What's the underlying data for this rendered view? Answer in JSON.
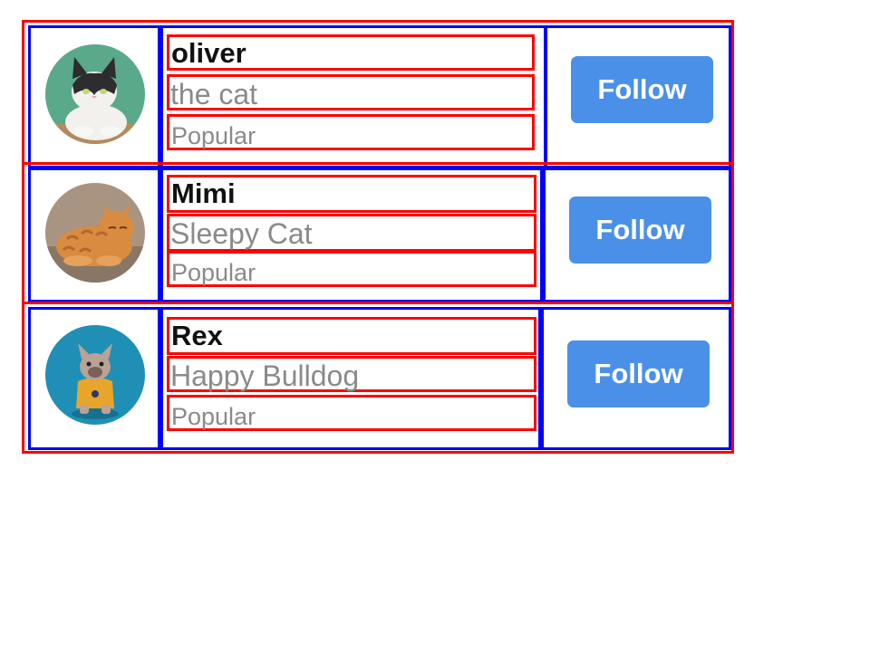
{
  "users": [
    {
      "name": "oliver",
      "subtitle": "the cat",
      "tag": "Popular",
      "follow_label": "Follow",
      "avatar_colors": {
        "bg": "#5aa98a",
        "fur_white": "#f2f1ee",
        "fur_dark": "#2d2c2f",
        "table": "#b58a5c"
      }
    },
    {
      "name": "Mimi",
      "subtitle": "Sleepy Cat",
      "tag": "Popular",
      "follow_label": "Follow",
      "avatar_colors": {
        "bg": "#a89480",
        "fur": "#d98c40",
        "stripes": "#b5682a",
        "floor": "#8a7664"
      }
    },
    {
      "name": "Rex",
      "subtitle": "Happy Bulldog",
      "tag": "Popular",
      "follow_label": "Follow",
      "avatar_colors": {
        "bg": "#1f8fb5",
        "dog": "#b9a296",
        "shirt": "#e7a52a"
      }
    }
  ],
  "colors": {
    "button": "#4a90e8",
    "outer_outline": "#ff0000",
    "cell_outline": "#0000ff"
  }
}
